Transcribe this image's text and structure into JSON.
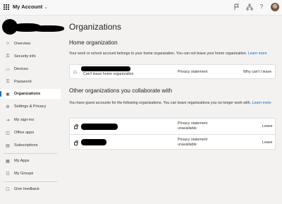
{
  "header": {
    "app_title": "My Account",
    "icons": [
      "waffle-icon",
      "flag-icon",
      "org-chart-icon",
      "help-icon",
      "avatar"
    ]
  },
  "nav": {
    "items": [
      {
        "label": "Overview",
        "icon": "person-icon"
      },
      {
        "label": "Security info",
        "icon": "key-icon"
      },
      {
        "label": "Devices",
        "icon": "laptop-icon"
      },
      {
        "label": "Password",
        "icon": "key-icon"
      },
      {
        "label": "Organizations",
        "icon": "briefcase-icon",
        "active": true
      },
      {
        "label": "Settings & Privacy",
        "icon": "gear-icon"
      },
      {
        "label": "My sign-ins",
        "icon": "signin-icon"
      },
      {
        "label": "Office apps",
        "icon": "office-icon"
      },
      {
        "label": "Subscriptions",
        "icon": "subscriptions-icon"
      },
      {
        "label": "My Apps",
        "icon": "apps-icon"
      },
      {
        "label": "My Groups",
        "icon": "groups-icon"
      },
      {
        "label": "Give feedback",
        "icon": "feedback-icon"
      }
    ]
  },
  "main": {
    "title": "Organizations",
    "home_section": {
      "heading": "Home organization",
      "description": "Your work or school account belongs to your home organization. You can not leave your home organization.",
      "learn_more": "Learn more",
      "card": {
        "subtitle": "Can't leave home organization",
        "privacy_link": "Privacy statement",
        "why_link": "Why can't I leave"
      }
    },
    "other_section": {
      "heading": "Other organizations you collaborate with",
      "description": "You have guest accounts for the following organizations. You can leave organizations you no longer work with.",
      "learn_more": "Learn more",
      "rows": [
        {
          "privacy_line1": "Privacy statement",
          "privacy_line2": "unavailable",
          "action": "Leave"
        },
        {
          "privacy_line1": "Privacy statement",
          "privacy_line2": "unavailable",
          "action": "Leave"
        }
      ]
    }
  },
  "colors": {
    "accent": "#0f6cbd",
    "background": "#f3f2f1",
    "redaction": "#000000"
  }
}
